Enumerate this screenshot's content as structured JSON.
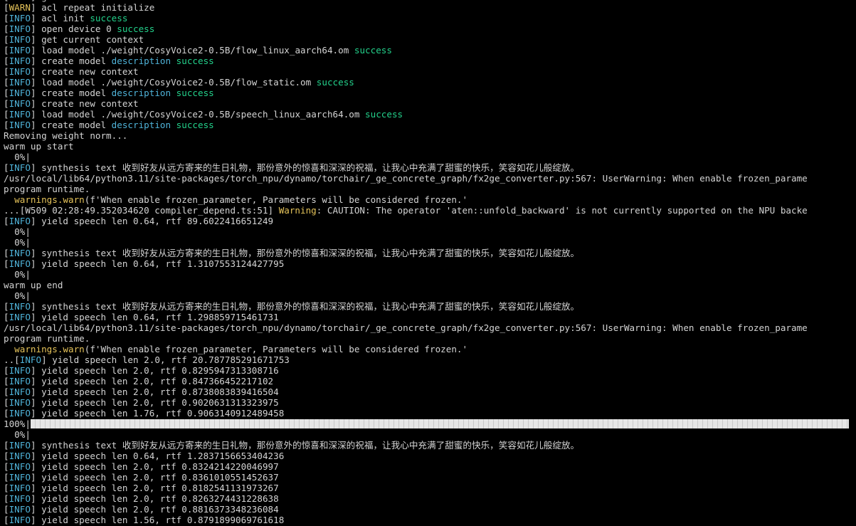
{
  "colors": {
    "background": "#000000",
    "text": "#d4d4d4",
    "info": "#4fb3d9",
    "warn": "#e5c35a",
    "success": "#23d18b"
  },
  "lines": [
    [
      {
        "t": "[INFO] get current context ",
        "c": "plain"
      }
    ],
    [
      {
        "t": "[",
        "c": "bracket"
      },
      {
        "t": "WARN",
        "c": "warn"
      },
      {
        "t": "] acl repeat initialize",
        "c": "plain"
      }
    ],
    [
      {
        "t": "[",
        "c": "bracket"
      },
      {
        "t": "INFO",
        "c": "info"
      },
      {
        "t": "] acl init ",
        "c": "plain"
      },
      {
        "t": "success",
        "c": "success"
      }
    ],
    [
      {
        "t": "[",
        "c": "bracket"
      },
      {
        "t": "INFO",
        "c": "info"
      },
      {
        "t": "] open device 0 ",
        "c": "plain"
      },
      {
        "t": "success",
        "c": "success"
      }
    ],
    [
      {
        "t": "[",
        "c": "bracket"
      },
      {
        "t": "INFO",
        "c": "info"
      },
      {
        "t": "] get current context",
        "c": "plain"
      }
    ],
    [
      {
        "t": "[",
        "c": "bracket"
      },
      {
        "t": "INFO",
        "c": "info"
      },
      {
        "t": "] load model ./weight/CosyVoice2-0.5B/flow_linux_aarch64.om ",
        "c": "plain"
      },
      {
        "t": "success",
        "c": "success"
      }
    ],
    [
      {
        "t": "[",
        "c": "bracket"
      },
      {
        "t": "INFO",
        "c": "info"
      },
      {
        "t": "] create model ",
        "c": "plain"
      },
      {
        "t": "description",
        "c": "desc"
      },
      {
        "t": " ",
        "c": "plain"
      },
      {
        "t": "success",
        "c": "success"
      }
    ],
    [
      {
        "t": "[",
        "c": "bracket"
      },
      {
        "t": "INFO",
        "c": "info"
      },
      {
        "t": "] create new context",
        "c": "plain"
      }
    ],
    [
      {
        "t": "[",
        "c": "bracket"
      },
      {
        "t": "INFO",
        "c": "info"
      },
      {
        "t": "] load model ./weight/CosyVoice2-0.5B/flow_static.om ",
        "c": "plain"
      },
      {
        "t": "success",
        "c": "success"
      }
    ],
    [
      {
        "t": "[",
        "c": "bracket"
      },
      {
        "t": "INFO",
        "c": "info"
      },
      {
        "t": "] create model ",
        "c": "plain"
      },
      {
        "t": "description",
        "c": "desc"
      },
      {
        "t": " ",
        "c": "plain"
      },
      {
        "t": "success",
        "c": "success"
      }
    ],
    [
      {
        "t": "[",
        "c": "bracket"
      },
      {
        "t": "INFO",
        "c": "info"
      },
      {
        "t": "] create new context",
        "c": "plain"
      }
    ],
    [
      {
        "t": "[",
        "c": "bracket"
      },
      {
        "t": "INFO",
        "c": "info"
      },
      {
        "t": "] load model ./weight/CosyVoice2-0.5B/speech_linux_aarch64.om ",
        "c": "plain"
      },
      {
        "t": "success",
        "c": "success"
      }
    ],
    [
      {
        "t": "[",
        "c": "bracket"
      },
      {
        "t": "INFO",
        "c": "info"
      },
      {
        "t": "] create model ",
        "c": "plain"
      },
      {
        "t": "description",
        "c": "desc"
      },
      {
        "t": " ",
        "c": "plain"
      },
      {
        "t": "success",
        "c": "success"
      }
    ],
    [
      {
        "t": "Removing weight norm...",
        "c": "plain"
      }
    ],
    [
      {
        "t": "warm up start",
        "c": "plain"
      }
    ],
    [
      {
        "t": "  0%|",
        "c": "plain"
      }
    ],
    [
      {
        "t": "[",
        "c": "bracket"
      },
      {
        "t": "INFO",
        "c": "info"
      },
      {
        "t": "] synthesis text 收到好友从远方寄来的生日礼物，那份意外的惊喜和深深的祝福，让我心中充满了甜蜜的快乐，笑容如花儿般绽放。",
        "c": "plain"
      }
    ],
    [
      {
        "t": "/usr/local/lib64/python3.11/site-packages/torch_npu/dynamo/torchair/_ge_concrete_graph/fx2ge_converter.py:567: UserWarning: When enable frozen_parame",
        "c": "plain"
      }
    ],
    [
      {
        "t": "program runtime.",
        "c": "plain"
      }
    ],
    [
      {
        "t": "  ",
        "c": "plain"
      },
      {
        "t": "warnings.warn",
        "c": "warnfn"
      },
      {
        "t": "(f'When enable frozen_parameter, Parameters will be considered frozen.'",
        "c": "plain"
      }
    ],
    [
      {
        "t": "...[W509 02:28:49.352034620 compiler_depend.ts:51] ",
        "c": "plain"
      },
      {
        "t": "Warning",
        "c": "warningword"
      },
      {
        "t": ": CAUTION: The operator 'aten::unfold_backward' is not currently supported on the NPU backe",
        "c": "plain"
      }
    ],
    [
      {
        "t": "[",
        "c": "bracket"
      },
      {
        "t": "INFO",
        "c": "info"
      },
      {
        "t": "] yield speech len 0.64, rtf 89.6022416651249",
        "c": "plain"
      }
    ],
    [
      {
        "t": "  0%|",
        "c": "plain"
      }
    ],
    [
      {
        "t": "  0%|",
        "c": "plain"
      }
    ],
    [
      {
        "t": "[",
        "c": "bracket"
      },
      {
        "t": "INFO",
        "c": "info"
      },
      {
        "t": "] synthesis text 收到好友从远方寄来的生日礼物，那份意外的惊喜和深深的祝福，让我心中充满了甜蜜的快乐，笑容如花儿般绽放。",
        "c": "plain"
      }
    ],
    [
      {
        "t": "[",
        "c": "bracket"
      },
      {
        "t": "INFO",
        "c": "info"
      },
      {
        "t": "] yield speech len 0.64, rtf 1.3107553124427795",
        "c": "plain"
      }
    ],
    [
      {
        "t": "  0%|",
        "c": "plain"
      }
    ],
    [
      {
        "t": "warm up end",
        "c": "plain"
      }
    ],
    [
      {
        "t": "  0%|",
        "c": "plain"
      }
    ],
    [
      {
        "t": "[",
        "c": "bracket"
      },
      {
        "t": "INFO",
        "c": "info"
      },
      {
        "t": "] synthesis text 收到好友从远方寄来的生日礼物，那份意外的惊喜和深深的祝福，让我心中充满了甜蜜的快乐，笑容如花儿般绽放。",
        "c": "plain"
      }
    ],
    [
      {
        "t": "[",
        "c": "bracket"
      },
      {
        "t": "INFO",
        "c": "info"
      },
      {
        "t": "] yield speech len 0.64, rtf 1.298859715461731",
        "c": "plain"
      }
    ],
    [
      {
        "t": "/usr/local/lib64/python3.11/site-packages/torch_npu/dynamo/torchair/_ge_concrete_graph/fx2ge_converter.py:567: UserWarning: When enable frozen_parame",
        "c": "plain"
      }
    ],
    [
      {
        "t": "program runtime.",
        "c": "plain"
      }
    ],
    [
      {
        "t": "  ",
        "c": "plain"
      },
      {
        "t": "warnings.warn",
        "c": "warnfn"
      },
      {
        "t": "(f'When enable frozen_parameter, Parameters will be considered frozen.'",
        "c": "plain"
      }
    ],
    [
      {
        "t": "..[",
        "c": "bracket"
      },
      {
        "t": "INFO",
        "c": "info"
      },
      {
        "t": "] yield speech len 2.0, rtf 20.787785291671753",
        "c": "plain"
      }
    ],
    [
      {
        "t": "[",
        "c": "bracket"
      },
      {
        "t": "INFO",
        "c": "info"
      },
      {
        "t": "] yield speech len 2.0, rtf 0.8295947313308716",
        "c": "plain"
      }
    ],
    [
      {
        "t": "[",
        "c": "bracket"
      },
      {
        "t": "INFO",
        "c": "info"
      },
      {
        "t": "] yield speech len 2.0, rtf 0.847366452217102",
        "c": "plain"
      }
    ],
    [
      {
        "t": "[",
        "c": "bracket"
      },
      {
        "t": "INFO",
        "c": "info"
      },
      {
        "t": "] yield speech len 2.0, rtf 0.8738083839416504",
        "c": "plain"
      }
    ],
    [
      {
        "t": "[",
        "c": "bracket"
      },
      {
        "t": "INFO",
        "c": "info"
      },
      {
        "t": "] yield speech len 2.0, rtf 0.9020631313323975",
        "c": "plain"
      }
    ],
    [
      {
        "t": "[",
        "c": "bracket"
      },
      {
        "t": "INFO",
        "c": "info"
      },
      {
        "t": "] yield speech len 1.76, rtf 0.9063140912489458",
        "c": "plain"
      }
    ],
    [
      {
        "t": "100%|",
        "c": "plain"
      },
      {
        "bar": true,
        "progress": 1.0
      }
    ],
    [
      {
        "t": "  0%|",
        "c": "plain"
      }
    ],
    [
      {
        "t": "[",
        "c": "bracket"
      },
      {
        "t": "INFO",
        "c": "info"
      },
      {
        "t": "] synthesis text 收到好友从远方寄来的生日礼物，那份意外的惊喜和深深的祝福，让我心中充满了甜蜜的快乐，笑容如花儿般绽放。",
        "c": "plain"
      }
    ],
    [
      {
        "t": "[",
        "c": "bracket"
      },
      {
        "t": "INFO",
        "c": "info"
      },
      {
        "t": "] yield speech len 0.64, rtf 1.2837156653404236",
        "c": "plain"
      }
    ],
    [
      {
        "t": "[",
        "c": "bracket"
      },
      {
        "t": "INFO",
        "c": "info"
      },
      {
        "t": "] yield speech len 2.0, rtf 0.8324214220046997",
        "c": "plain"
      }
    ],
    [
      {
        "t": "[",
        "c": "bracket"
      },
      {
        "t": "INFO",
        "c": "info"
      },
      {
        "t": "] yield speech len 2.0, rtf 0.8361010551452637",
        "c": "plain"
      }
    ],
    [
      {
        "t": "[",
        "c": "bracket"
      },
      {
        "t": "INFO",
        "c": "info"
      },
      {
        "t": "] yield speech len 2.0, rtf 0.8182541131973267",
        "c": "plain"
      }
    ],
    [
      {
        "t": "[",
        "c": "bracket"
      },
      {
        "t": "INFO",
        "c": "info"
      },
      {
        "t": "] yield speech len 2.0, rtf 0.8263274431228638",
        "c": "plain"
      }
    ],
    [
      {
        "t": "[",
        "c": "bracket"
      },
      {
        "t": "INFO",
        "c": "info"
      },
      {
        "t": "] yield speech len 2.0, rtf 0.8816373348236084",
        "c": "plain"
      }
    ],
    [
      {
        "t": "[",
        "c": "bracket"
      },
      {
        "t": "INFO",
        "c": "info"
      },
      {
        "t": "] yield speech len 1.56, rtf 0.8791899069761618",
        "c": "plain"
      }
    ]
  ]
}
